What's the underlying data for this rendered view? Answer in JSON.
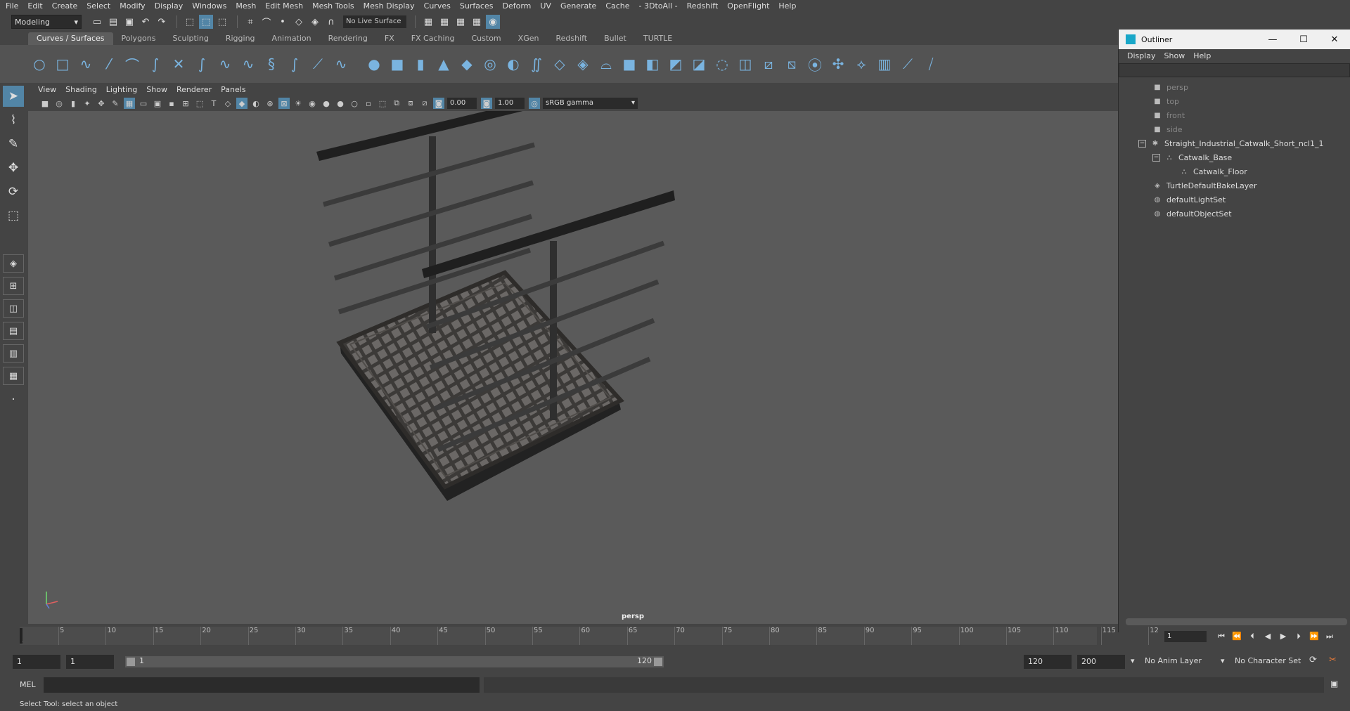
{
  "menubar": [
    "File",
    "Edit",
    "Create",
    "Select",
    "Modify",
    "Display",
    "Windows",
    "Mesh",
    "Edit Mesh",
    "Mesh Tools",
    "Mesh Display",
    "Curves",
    "Surfaces",
    "Deform",
    "UV",
    "Generate",
    "Cache",
    "- 3DtoAll -",
    "Redshift",
    "OpenFlight",
    "Help"
  ],
  "statusline": {
    "mode": "Modeling",
    "live_surface": "No Live Surface"
  },
  "shelf_tabs": [
    "Curves / Surfaces",
    "Polygons",
    "Sculpting",
    "Rigging",
    "Animation",
    "Rendering",
    "FX",
    "FX Caching",
    "Custom",
    "XGen",
    "Redshift",
    "Bullet",
    "TURTLE"
  ],
  "panel_menu": [
    "View",
    "Shading",
    "Lighting",
    "Show",
    "Renderer",
    "Panels"
  ],
  "panel_toolbar": {
    "exposure": "0.00",
    "gamma_value": "1.00",
    "color_space": "sRGB gamma"
  },
  "viewport": {
    "camera_label": "persp"
  },
  "outliner": {
    "title": "Outliner",
    "menu": [
      "Display",
      "Show",
      "Help"
    ],
    "items": [
      {
        "label": "persp",
        "dim": true
      },
      {
        "label": "top",
        "dim": true
      },
      {
        "label": "front",
        "dim": true
      },
      {
        "label": "side",
        "dim": true
      },
      {
        "label": "Straight_Industrial_Catwalk_Short_ncl1_1"
      },
      {
        "label": "Catwalk_Base"
      },
      {
        "label": "Catwalk_Floor"
      },
      {
        "label": "TurtleDefaultBakeLayer"
      },
      {
        "label": "defaultLightSet"
      },
      {
        "label": "defaultObjectSet"
      }
    ]
  },
  "timeline": {
    "ticks": [
      "5",
      "10",
      "15",
      "20",
      "25",
      "30",
      "35",
      "40",
      "45",
      "50",
      "55",
      "60",
      "65",
      "70",
      "75",
      "80",
      "85",
      "90",
      "95",
      "100",
      "105",
      "110",
      "115",
      "12"
    ],
    "start_tick": "1",
    "current_frame": "1"
  },
  "range": {
    "start": "1",
    "playback_start": "1",
    "bar_start": "1",
    "bar_end": "120",
    "playback_end": "120",
    "end": "200",
    "anim_layer": "No Anim Layer",
    "character_set": "No Character Set"
  },
  "cmdline": {
    "lang": "MEL"
  },
  "helpline": {
    "text": "Select Tool: select an object"
  },
  "colors": {
    "accent": "#5285a6",
    "viewport_bg": "#5a5a5a",
    "ui_bg": "#444444",
    "icon_blue": "#7ab4e0"
  }
}
